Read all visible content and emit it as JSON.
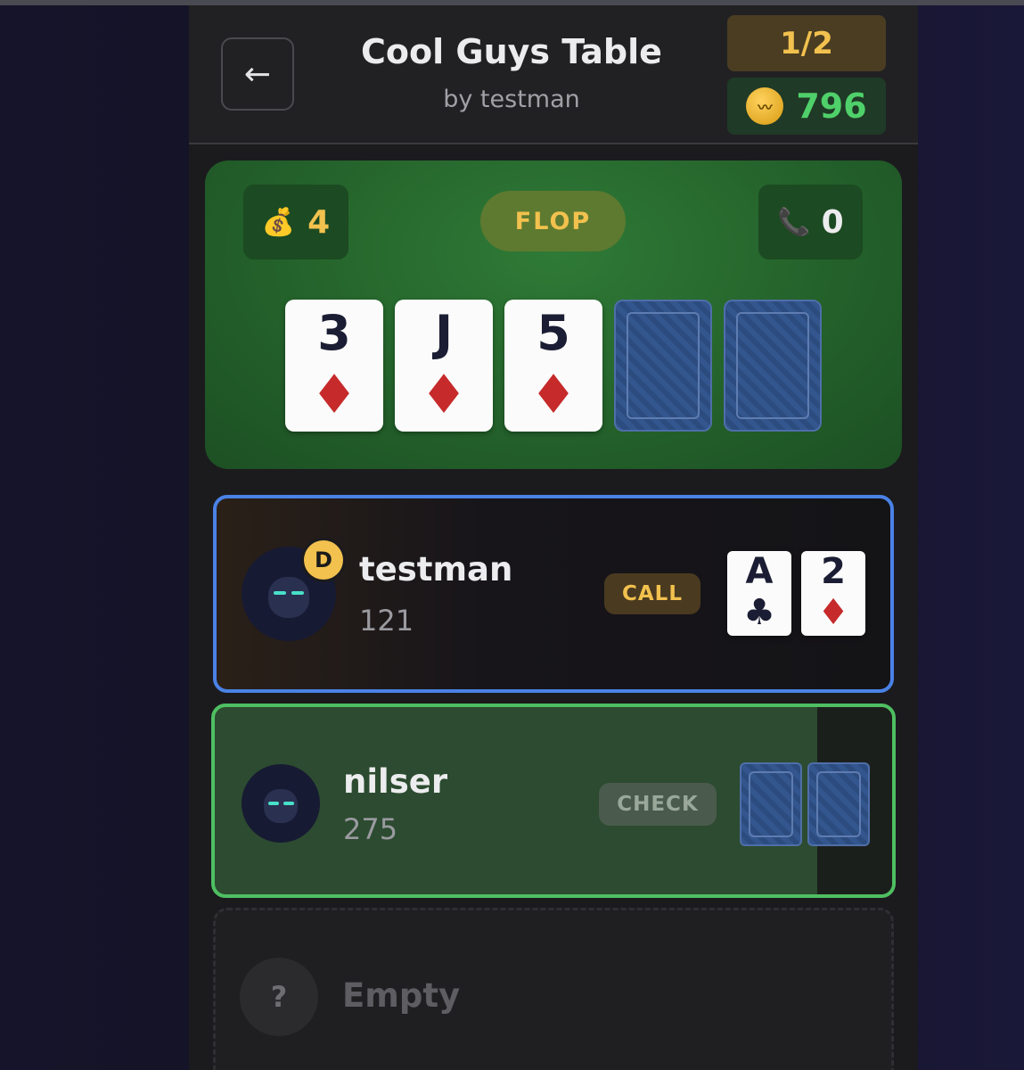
{
  "header": {
    "back_label": "←",
    "title": "Cool Guys Table",
    "subtitle": "by testman",
    "blinds": "1/2",
    "balance": "796",
    "coin_symbol": "〰"
  },
  "table": {
    "pot": "4",
    "pot_icon": "💰",
    "stage": "FLOP",
    "to_call": "0",
    "to_call_icon": "📞",
    "board": [
      {
        "rank": "3",
        "suit": "♦",
        "color": "red"
      },
      {
        "rank": "J",
        "suit": "♦",
        "color": "red"
      },
      {
        "rank": "5",
        "suit": "♦",
        "color": "red"
      },
      {
        "hidden": true
      },
      {
        "hidden": true
      }
    ]
  },
  "players": [
    {
      "name": "testman",
      "stack": "121",
      "dealer_badge": "D",
      "last_action": "CALL",
      "cards": [
        {
          "rank": "A",
          "suit": "♣",
          "color": "black"
        },
        {
          "rank": "2",
          "suit": "♦",
          "color": "red"
        }
      ]
    },
    {
      "name": "nilser",
      "stack": "275",
      "last_action": "CHECK",
      "cards": [
        {
          "hidden": true
        },
        {
          "hidden": true
        }
      ]
    }
  ],
  "empty_seat": {
    "icon": "?",
    "label": "Empty"
  },
  "colors": {
    "active_border": "#4a82e6",
    "turn_border": "#4fbf62",
    "gold": "#f2c14e",
    "balance_green": "#4fd06a"
  }
}
